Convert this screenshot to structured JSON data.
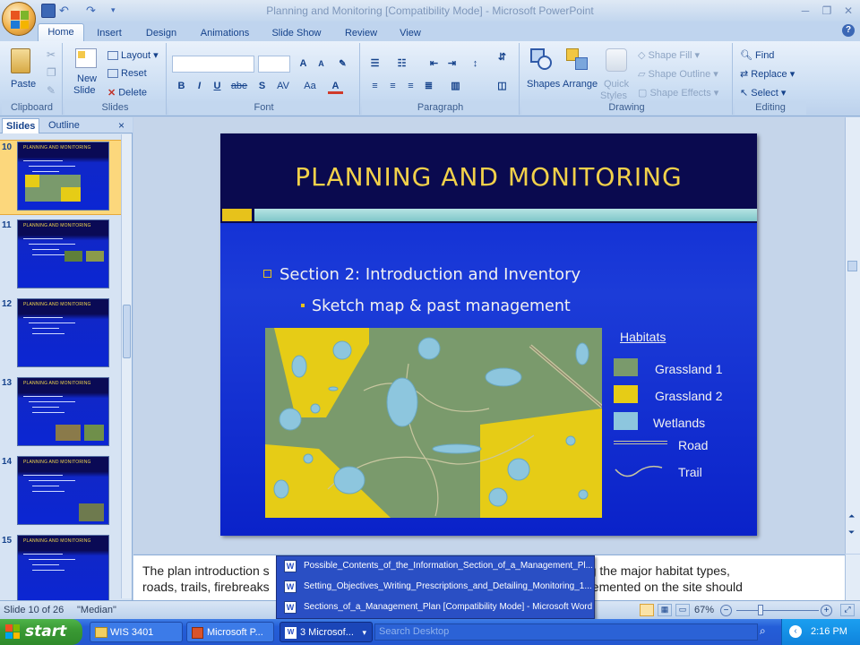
{
  "window": {
    "title": "Planning and Monitoring [Compatibility Mode] - Microsoft PowerPoint"
  },
  "ribbon": {
    "tabs": [
      "Home",
      "Insert",
      "Design",
      "Animations",
      "Slide Show",
      "Review",
      "View"
    ],
    "active_tab": "Home",
    "clipboard": {
      "paste": "Paste",
      "label": "Clipboard"
    },
    "slides": {
      "new_slide_1": "New",
      "new_slide_2": "Slide",
      "layout": "Layout",
      "reset": "Reset",
      "delete": "Delete",
      "label": "Slides"
    },
    "font": {
      "bold": "B",
      "italic": "I",
      "underline": "U",
      "strike": "abe",
      "shadow": "S",
      "spacing": "AV",
      "case": "Aa",
      "color": "A",
      "grow": "A",
      "shrink": "A",
      "label": "Font"
    },
    "paragraph": {
      "label": "Paragraph"
    },
    "drawing": {
      "shapes": "Shapes",
      "arrange": "Arrange",
      "quick_styles_1": "Quick",
      "quick_styles_2": "Styles",
      "shape_fill": "Shape Fill",
      "shape_outline": "Shape Outline",
      "shape_effects": "Shape Effects",
      "label": "Drawing"
    },
    "editing": {
      "find": "Find",
      "replace": "Replace",
      "select": "Select",
      "label": "Editing"
    }
  },
  "left_pane": {
    "tabs": [
      "Slides",
      "Outline"
    ],
    "close": "×",
    "thumbnails": [
      {
        "num": "10",
        "title": "PLANNING AND MONITORING",
        "selected": true
      },
      {
        "num": "11",
        "title": "PLANNING AND MONITORING"
      },
      {
        "num": "12",
        "title": "PLANNING AND MONITORING"
      },
      {
        "num": "13",
        "title": "PLANNING AND MONITORING"
      },
      {
        "num": "14",
        "title": "PLANNING AND MONITORING"
      },
      {
        "num": "15",
        "title": "PLANNING AND MONITORING"
      }
    ]
  },
  "slide": {
    "title": "PLANNING AND MONITORING",
    "bullet1": "Section 2: Introduction and Inventory",
    "bullet2": "Sketch map & past management",
    "legend": {
      "title": "Habitats",
      "items": [
        {
          "label": "Grassland 1",
          "color": "#7a9a6c"
        },
        {
          "label": "Grassland 2",
          "color": "#e6cc16"
        },
        {
          "label": "Wetlands",
          "color": "#8dc6de"
        },
        {
          "label": "Road"
        },
        {
          "label": "Trail"
        }
      ]
    }
  },
  "notes": {
    "line1": "The plan introduction s                                                                          site showing the major habitat types,",
    "line2": "roads, trails, firebreaks                                                                        5 years) implemented on the site should"
  },
  "status": {
    "slide_of": "Slide 10 of 26",
    "theme": "\"Median\"",
    "zoom": "67%"
  },
  "popup": {
    "items": [
      "Possible_Contents_of_the_Information_Section_of_a_Management_Pl...",
      "Setting_Objectives_Writing_Prescriptions_and_Detailing_Monitoring_1...",
      "Sections_of_a_Management_Plan [Compatibility Mode] - Microsoft Word"
    ]
  },
  "taskbar": {
    "start": "start",
    "buttons": [
      "WIS 3401",
      "Microsoft P...",
      "3 Microsof..."
    ],
    "search_placeholder": "Search Desktop",
    "clock": "2:16 PM"
  },
  "colors": {
    "ribbon_blue": "#15428b",
    "slide_blue": "#0b26d3",
    "slide_title": "#f2d14a"
  }
}
